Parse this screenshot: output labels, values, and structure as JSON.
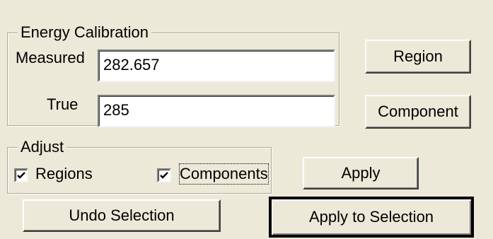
{
  "energy_calibration": {
    "title": "Energy Calibration",
    "measured_label": "Measured",
    "measured_value": "282.657",
    "true_label": "True",
    "true_value": "285"
  },
  "buttons": {
    "region": "Region",
    "component": "Component",
    "apply": "Apply",
    "undo_selection": "Undo Selection",
    "apply_to_selection": "Apply to Selection"
  },
  "adjust": {
    "title": "Adjust",
    "regions_label": "Regions",
    "regions_checked": true,
    "components_label": "Components",
    "components_checked": true
  },
  "icons": {
    "checkmark": "checkmark-icon"
  }
}
